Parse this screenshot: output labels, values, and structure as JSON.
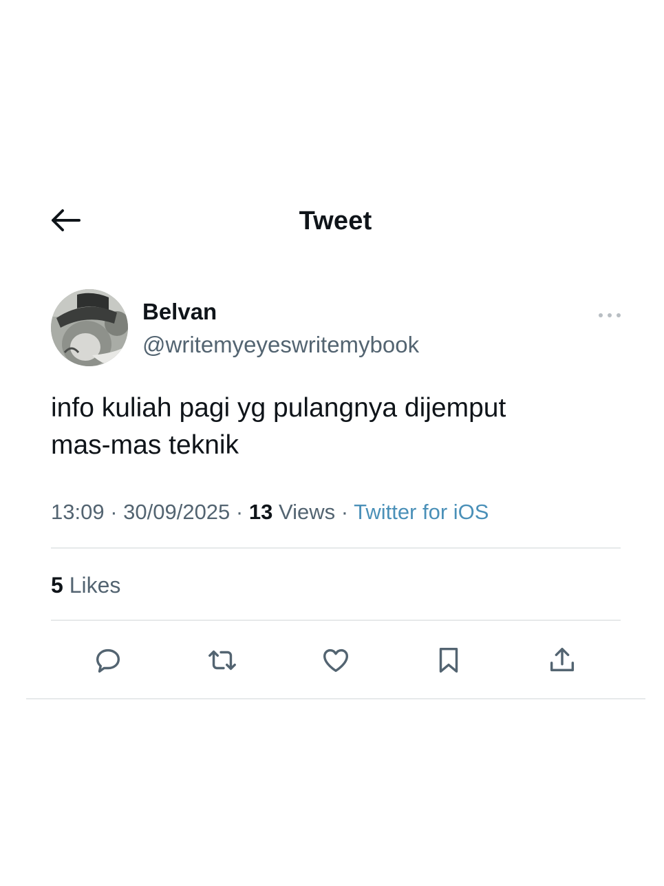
{
  "header": {
    "title": "Tweet",
    "back_icon": "arrow-left-icon"
  },
  "author": {
    "name": "Belvan",
    "handle": "@writemyeyeswritemybook",
    "more_icon": "more-horizontal-icon"
  },
  "tweet": {
    "text_line1": "info kuliah pagi yg pulangnya dijemput",
    "text_line2": "mas-mas teknik"
  },
  "meta": {
    "time": "13:09",
    "separator": " · ",
    "date": "30/09/2025",
    "views_count": "13",
    "views_label": " Views",
    "source": "Twitter for iOS"
  },
  "stats": {
    "likes_count": "5",
    "likes_label": " Likes"
  },
  "actions": [
    {
      "icon": "reply-icon"
    },
    {
      "icon": "retweet-icon"
    },
    {
      "icon": "like-icon"
    },
    {
      "icon": "bookmark-icon"
    },
    {
      "icon": "share-icon"
    }
  ],
  "colors": {
    "text": "#0f1419",
    "secondary": "#536471",
    "link": "#4a90b8",
    "divider": "#e6e9ea",
    "background": "#ffffff"
  }
}
